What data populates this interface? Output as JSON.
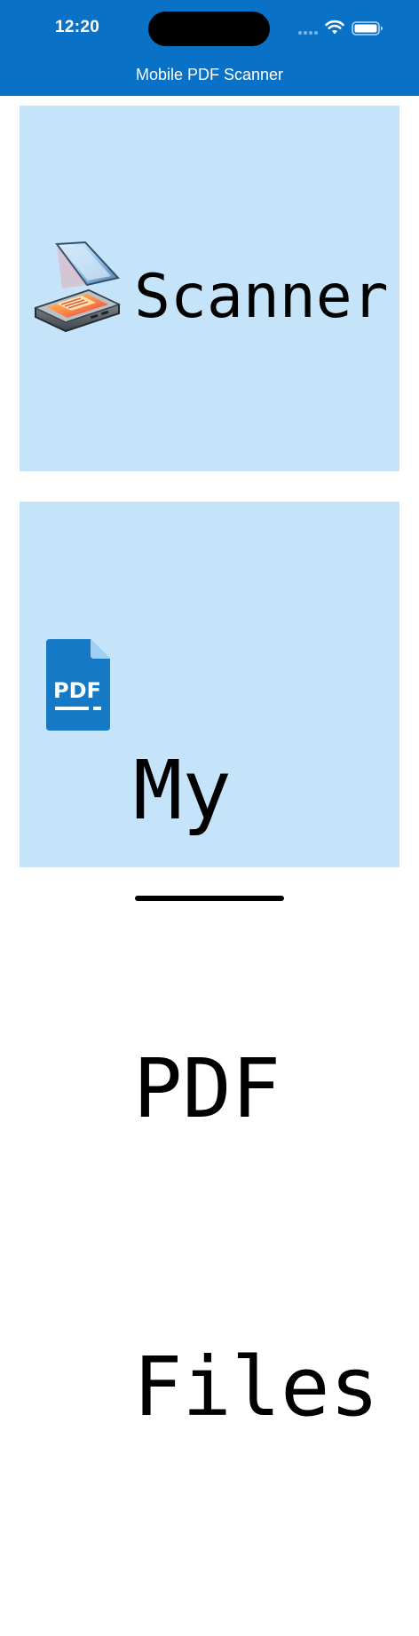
{
  "status_bar": {
    "time": "12:20"
  },
  "nav": {
    "title": "Mobile PDF Scanner"
  },
  "tiles": {
    "scanner": {
      "label": "Scanner",
      "icon": "flatbed-scanner-icon"
    },
    "files": {
      "lines": [
        "My",
        "PDF",
        "Files"
      ],
      "icon": "pdf-file-icon",
      "icon_text": "PDF"
    }
  },
  "colors": {
    "header": "#0A72C6",
    "tile_background": "#C6E4F9",
    "pdf_icon": "#1679C5"
  }
}
